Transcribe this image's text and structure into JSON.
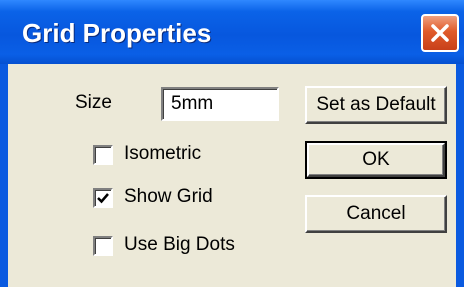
{
  "window": {
    "title": "Grid Properties"
  },
  "form": {
    "size_label": "Size",
    "size_value": "5mm",
    "isometric_label": "Isometric",
    "isometric_checked": false,
    "show_grid_label": "Show Grid",
    "show_grid_checked": true,
    "big_dots_label": "Use Big Dots",
    "big_dots_checked": false
  },
  "buttons": {
    "set_default_label": "Set as Default",
    "ok_label": "OK",
    "cancel_label": "Cancel"
  },
  "icons": {
    "close": "close-icon",
    "check": "checkmark-icon"
  },
  "colors": {
    "title_bar": "#0757de",
    "dialog_face": "#ece9d8",
    "close_button": "#e05a2a"
  }
}
